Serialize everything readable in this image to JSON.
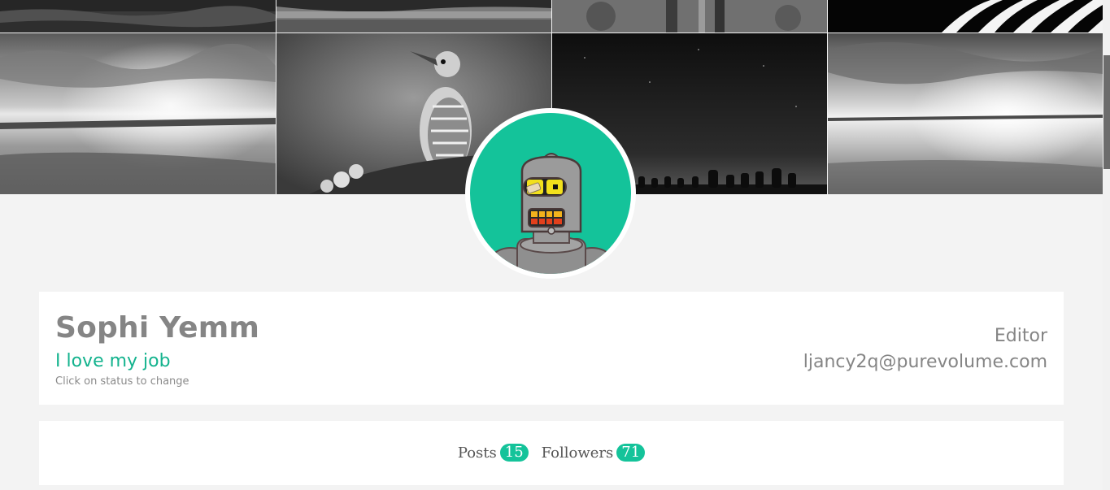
{
  "cover": {
    "tiles": [
      {
        "name": "forest"
      },
      {
        "name": "lake"
      },
      {
        "name": "bicycle"
      },
      {
        "name": "zebra"
      },
      {
        "name": "beach-clouds"
      },
      {
        "name": "woodpecker"
      },
      {
        "name": "night-sky-statues"
      },
      {
        "name": "sea-reflection"
      }
    ]
  },
  "avatar": {
    "icon": "robot-avatar",
    "background_color": "#14c39a"
  },
  "profile": {
    "name": "Sophi Yemm",
    "status": "I love my job",
    "status_hint": "Click on status to change",
    "role": "Editor",
    "email": "ljancy2q@purevolume.com"
  },
  "stats": {
    "posts_label": "Posts",
    "posts_count": "15",
    "followers_label": "Followers",
    "followers_count": "71"
  },
  "colors": {
    "accent": "#14c39a",
    "text_muted": "#858585",
    "page_background": "#f3f3f3"
  }
}
